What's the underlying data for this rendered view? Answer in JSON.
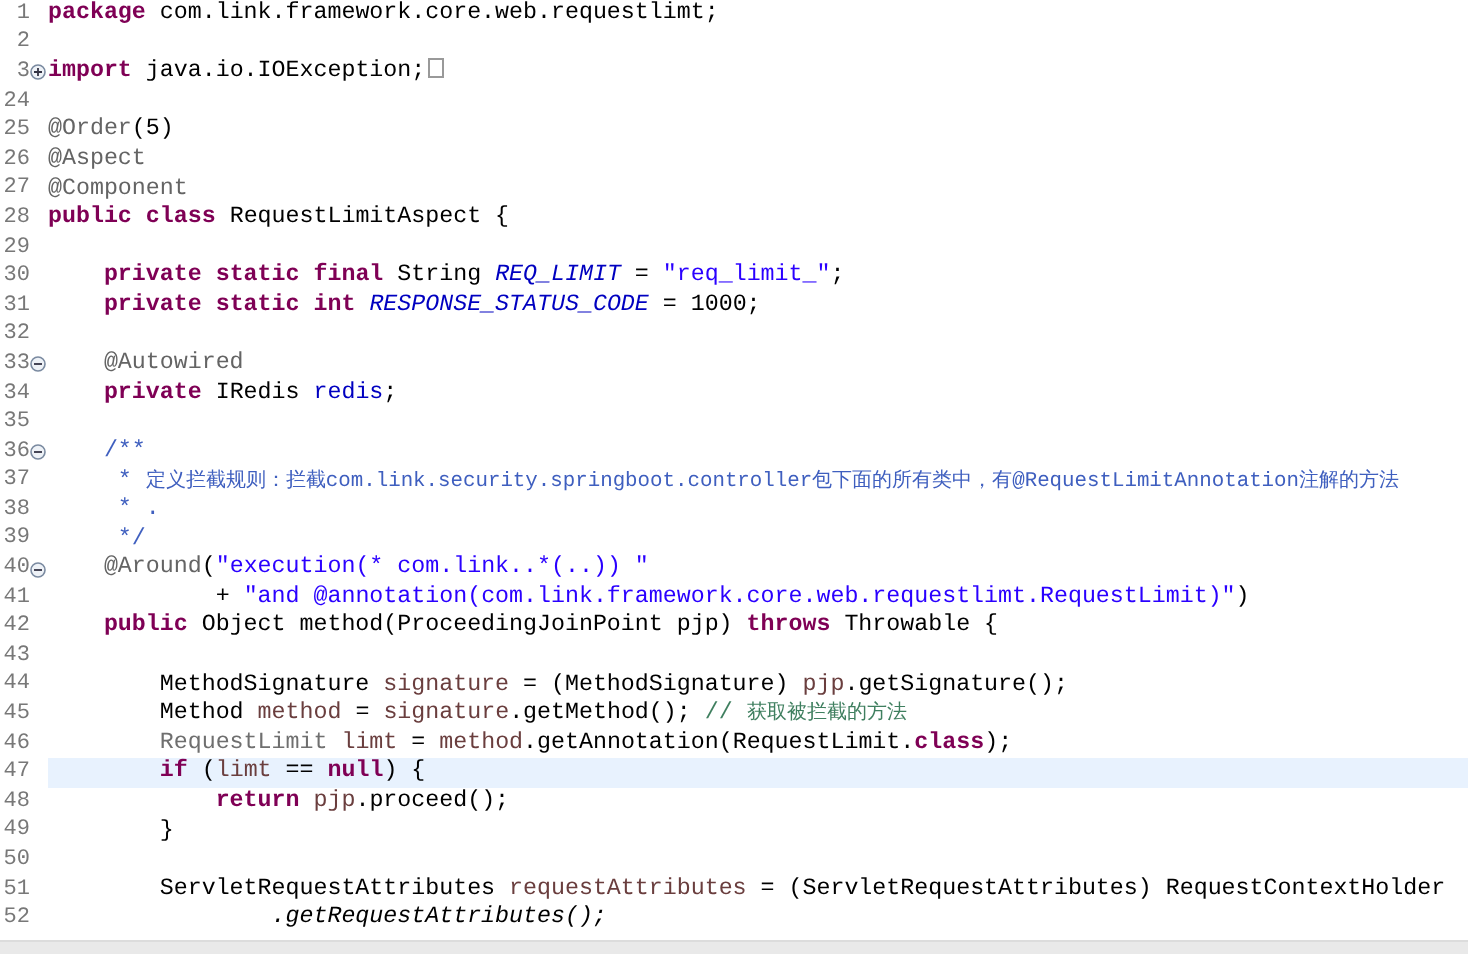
{
  "editor": {
    "lines": [
      {
        "number": "1",
        "current": false,
        "tokens": [
          {
            "kind": "keyword",
            "text": "package"
          },
          {
            "kind": "plain",
            "text": " com.link.framework.core.web.requestlimt;"
          }
        ]
      },
      {
        "number": "2",
        "current": false
      },
      {
        "number": "3",
        "current": false,
        "expanded": false,
        "tokens": [
          {
            "kind": "keyword",
            "text": "import"
          },
          {
            "kind": "plain",
            "text": " java.io.IOException;"
          }
        ]
      },
      {
        "number": "24",
        "current": false
      },
      {
        "number": "25",
        "current": false,
        "tokens": [
          {
            "kind": "annotation",
            "text": "@Order"
          },
          {
            "kind": "plain",
            "text": "(5)"
          }
        ]
      },
      {
        "number": "26",
        "current": false,
        "tokens": [
          {
            "kind": "annotation",
            "text": "@Aspect"
          }
        ]
      },
      {
        "number": "27",
        "current": false,
        "tokens": [
          {
            "kind": "annotation",
            "text": "@Component"
          }
        ]
      },
      {
        "number": "28",
        "current": false,
        "tokens": [
          {
            "kind": "keyword",
            "text": "public"
          },
          {
            "kind": "keyword",
            "text": " class"
          },
          {
            "kind": "plain",
            "text": " RequestLimitAspect {"
          }
        ]
      },
      {
        "number": "29",
        "current": false
      },
      {
        "number": "30",
        "current": false,
        "tokens": [
          {
            "kind": "keyword",
            "text": "    private"
          },
          {
            "kind": "keyword",
            "text": " static"
          },
          {
            "kind": "keyword",
            "text": " final"
          },
          {
            "kind": "plain",
            "text": " String "
          },
          {
            "kind": "constant",
            "text": "REQ_LIMIT"
          },
          {
            "kind": "plain",
            "text": " = "
          },
          {
            "kind": "string",
            "text": "\"req_limit_\""
          },
          {
            "kind": "plain",
            "text": ";"
          }
        ]
      },
      {
        "number": "31",
        "current": false,
        "tokens": [
          {
            "kind": "keyword",
            "text": "    private"
          },
          {
            "kind": "keyword",
            "text": " static"
          },
          {
            "kind": "keyword",
            "text": " int"
          },
          {
            "kind": "constant",
            "text": " RESPONSE_STATUS_CODE"
          },
          {
            "kind": "plain",
            "text": " = 1000;"
          }
        ]
      },
      {
        "number": "32",
        "current": false
      },
      {
        "number": "33",
        "current": false,
        "expanded": true,
        "tokens": [
          {
            "kind": "annotation",
            "text": "    @Autowired"
          }
        ]
      },
      {
        "number": "34",
        "current": false,
        "tokens": [
          {
            "kind": "keyword",
            "text": "    private"
          },
          {
            "kind": "plain",
            "text": " IRedis "
          },
          {
            "kind": "field",
            "text": "redis"
          },
          {
            "kind": "plain",
            "text": ";"
          }
        ]
      },
      {
        "number": "35",
        "current": false
      },
      {
        "number": "36",
        "current": false,
        "expanded": true,
        "tokens": [
          {
            "kind": "doc",
            "text": "    /**"
          }
        ]
      },
      {
        "number": "37",
        "current": false,
        "tokens": [
          {
            "kind": "doc",
            "text": "     * "
          },
          {
            "kind": "doc_cjk",
            "text": "定义拦截规则：拦截"
          },
          {
            "kind": "doc_small",
            "text": "com.link.security.springboot.controller"
          },
          {
            "kind": "doc_cjk",
            "text": "包下面的所有类中，有"
          },
          {
            "kind": "doc_small",
            "text": "@RequestLimitAnnotation"
          },
          {
            "kind": "doc_cjk",
            "text": "注解的方法"
          }
        ]
      },
      {
        "number": "38",
        "current": false,
        "tokens": [
          {
            "kind": "doc",
            "text": "     * ."
          }
        ]
      },
      {
        "number": "39",
        "current": false,
        "tokens": [
          {
            "kind": "doc",
            "text": "     */"
          }
        ]
      },
      {
        "number": "40",
        "current": false,
        "expanded": true,
        "tokens": [
          {
            "kind": "annotation",
            "text": "    @Around"
          },
          {
            "kind": "plain",
            "text": "("
          },
          {
            "kind": "string",
            "text": "\"execution(* com.link..*(..)) \""
          }
        ]
      },
      {
        "number": "41",
        "current": false,
        "tokens": [
          {
            "kind": "plain",
            "text": "            + "
          },
          {
            "kind": "string",
            "text": "\"and @annotation(com.link.framework.core.web.requestlimt.RequestLimit)\""
          },
          {
            "kind": "plain",
            "text": ")"
          }
        ]
      },
      {
        "number": "42",
        "current": false,
        "tokens": [
          {
            "kind": "keyword",
            "text": "    public"
          },
          {
            "kind": "plain",
            "text": " Object method(ProceedingJoinPoint pjp) "
          },
          {
            "kind": "keyword",
            "text": "throws"
          },
          {
            "kind": "plain",
            "text": " Throwable {"
          }
        ]
      },
      {
        "number": "43",
        "current": false
      },
      {
        "number": "44",
        "current": false,
        "tokens": [
          {
            "kind": "plain",
            "text": "        MethodSignature "
          },
          {
            "kind": "local",
            "text": "signature"
          },
          {
            "kind": "plain",
            "text": " = (MethodSignature) "
          },
          {
            "kind": "local",
            "text": "pjp"
          },
          {
            "kind": "plain",
            "text": ".getSignature();"
          }
        ]
      },
      {
        "number": "45",
        "current": false,
        "tokens": [
          {
            "kind": "plain",
            "text": "        Method "
          },
          {
            "kind": "local",
            "text": "method"
          },
          {
            "kind": "plain",
            "text": " = "
          },
          {
            "kind": "local",
            "text": "signature"
          },
          {
            "kind": "plain",
            "text": ".getMethod(); "
          },
          {
            "kind": "comment",
            "text": "// "
          },
          {
            "kind": "comment_cjk",
            "text": "获取被拦截的方法"
          }
        ]
      },
      {
        "number": "46",
        "current": false,
        "tokens": [
          {
            "kind": "unused",
            "text": "        RequestLimit"
          },
          {
            "kind": "local",
            "text": " limt"
          },
          {
            "kind": "plain",
            "text": " = "
          },
          {
            "kind": "local",
            "text": "method"
          },
          {
            "kind": "plain",
            "text": ".getAnnotation(RequestLimit."
          },
          {
            "kind": "keyword",
            "text": "class"
          },
          {
            "kind": "plain",
            "text": ");"
          }
        ]
      },
      {
        "number": "47",
        "current": true,
        "tokens": [
          {
            "kind": "keyword",
            "text": "        if"
          },
          {
            "kind": "plain",
            "text": " ("
          },
          {
            "kind": "local",
            "text": "limt"
          },
          {
            "kind": "plain",
            "text": " == "
          },
          {
            "kind": "keyword",
            "text": "null"
          },
          {
            "kind": "plain",
            "text": ") {"
          }
        ]
      },
      {
        "number": "48",
        "current": false,
        "tokens": [
          {
            "kind": "keyword",
            "text": "            return"
          },
          {
            "kind": "local",
            "text": " pjp"
          },
          {
            "kind": "plain",
            "text": ".proceed();"
          }
        ]
      },
      {
        "number": "49",
        "current": false,
        "tokens": [
          {
            "kind": "plain",
            "text": "        }"
          }
        ]
      },
      {
        "number": "50",
        "current": false
      },
      {
        "number": "51",
        "current": false,
        "tokens": [
          {
            "kind": "plain",
            "text": "        ServletRequestAttributes "
          },
          {
            "kind": "local",
            "text": "requestAttributes"
          },
          {
            "kind": "plain",
            "text": " = (ServletRequestAttributes) RequestContextHolder"
          }
        ]
      },
      {
        "number": "52",
        "current": false,
        "tokens": [
          {
            "kind": "static_call",
            "text": "                .getRequestAttributes();"
          }
        ]
      }
    ]
  }
}
